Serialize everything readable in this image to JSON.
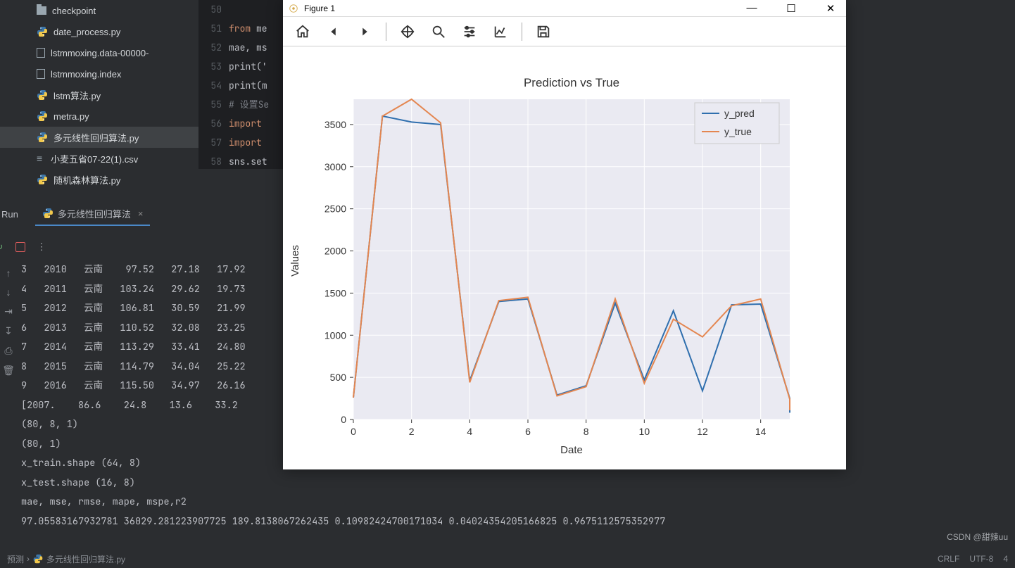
{
  "file_tree": [
    {
      "name": "checkpoint",
      "icon": "folder"
    },
    {
      "name": "date_process.py",
      "icon": "py"
    },
    {
      "name": "lstmmoxing.data-00000-",
      "icon": "file"
    },
    {
      "name": "lstmmoxing.index",
      "icon": "file"
    },
    {
      "name": "lstm算法.py",
      "icon": "py"
    },
    {
      "name": "metra.py",
      "icon": "py"
    },
    {
      "name": "多元线性回归算法.py",
      "icon": "py",
      "selected": true
    },
    {
      "name": "小麦五省07-22(1).csv",
      "icon": "csv"
    },
    {
      "name": "随机森林算法.py",
      "icon": "py"
    }
  ],
  "code": {
    "lines": [
      {
        "num": "50",
        "html": ""
      },
      {
        "num": "51",
        "html": "<span class='kw'>from</span> me"
      },
      {
        "num": "52",
        "html": "mae, ms"
      },
      {
        "num": "53",
        "html": "<span class='fn'>print</span>('"
      },
      {
        "num": "54",
        "html": "<span class='fn'>print</span>(m"
      },
      {
        "num": "55",
        "html": "<span class='cm'># 设置Se</span>"
      },
      {
        "num": "56",
        "html": "<span class='kw'>import</span> "
      },
      {
        "num": "57",
        "html": "<span class='kw'>import</span> "
      },
      {
        "num": "58",
        "html": "sns.set"
      }
    ]
  },
  "run_panel": {
    "run_label": "Run",
    "tab_name": "多元线性回归算法"
  },
  "console_rows": [
    "3   2010   云南    97.52   27.18   17.92",
    "4   2011   云南   103.24   29.62   19.73",
    "5   2012   云南   106.81   30.59   21.99",
    "6   2013   云南   110.52   32.08   23.25",
    "7   2014   云南   113.29   33.41   24.80",
    "8   2015   云南   114.79   34.04   25.22",
    "9   2016   云南   115.50   34.97   26.16",
    "[2007.    86.6    24.8    13.6    33.2",
    "(80, 8, 1)",
    "(80, 1)",
    "x_train.shape (64, 8)",
    "x_test.shape (16, 8)",
    "mae, mse, rmse, mape, mspe,r2",
    "97.05583167932781 36029.281223907725 189.8138067262435 0.10982424700171034 0.04024354205166825 0.9675112575352977"
  ],
  "figure": {
    "title": "Figure 1"
  },
  "status": {
    "breadcrumb1": "预测",
    "breadcrumb2": "多元线性回归算法.py",
    "crlf": "CRLF",
    "enc": "UTF-8",
    "spc": "4"
  },
  "watermark": "CSDN @甜辣uu",
  "chart_data": {
    "type": "line",
    "title": "Prediction vs True",
    "xlabel": "Date",
    "ylabel": "Values",
    "xlim": [
      0,
      15
    ],
    "ylim": [
      0,
      3800
    ],
    "x_ticks": [
      0,
      2,
      4,
      6,
      8,
      10,
      12,
      14
    ],
    "y_ticks": [
      0,
      500,
      1000,
      1500,
      2000,
      2500,
      3000,
      3500
    ],
    "x": [
      0,
      1,
      2,
      3,
      4,
      5,
      6,
      7,
      8,
      9,
      10,
      11,
      12,
      13,
      14,
      15
    ],
    "series": [
      {
        "name": "y_pred",
        "color": "#2f6fae",
        "values": [
          260,
          3600,
          3530,
          3500,
          460,
          1400,
          1430,
          290,
          400,
          1380,
          470,
          1290,
          340,
          1360,
          1370,
          250,
          80
        ]
      },
      {
        "name": "y_true",
        "color": "#e48650",
        "values": [
          260,
          3600,
          3800,
          3520,
          440,
          1410,
          1450,
          280,
          390,
          1430,
          430,
          1190,
          980,
          1350,
          1430,
          240,
          110
        ]
      }
    ],
    "legend": [
      "y_pred",
      "y_true"
    ],
    "legend_pos": "upper right"
  }
}
